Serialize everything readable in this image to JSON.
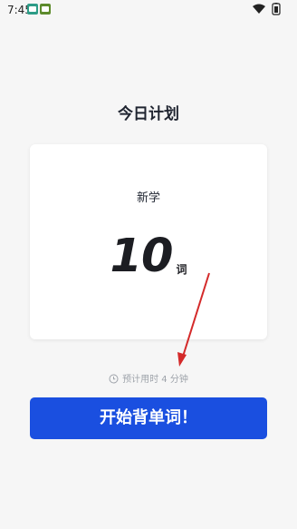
{
  "status_bar": {
    "time": "7:45"
  },
  "page": {
    "title": "今日计划"
  },
  "plan": {
    "label": "新学",
    "count": "10",
    "unit": "词"
  },
  "estimate": {
    "text": "预计用时 4 分钟"
  },
  "actions": {
    "start_label": "开始背单词！"
  },
  "icons": {
    "clock": "clock-icon",
    "wifi": "wifi-icon",
    "battery": "battery-icon"
  },
  "colors": {
    "background": "#f6f6f6",
    "card": "#ffffff",
    "primary": "#1a4fe0",
    "annotation": "#d42a2a",
    "muted": "#9ea3aa"
  }
}
